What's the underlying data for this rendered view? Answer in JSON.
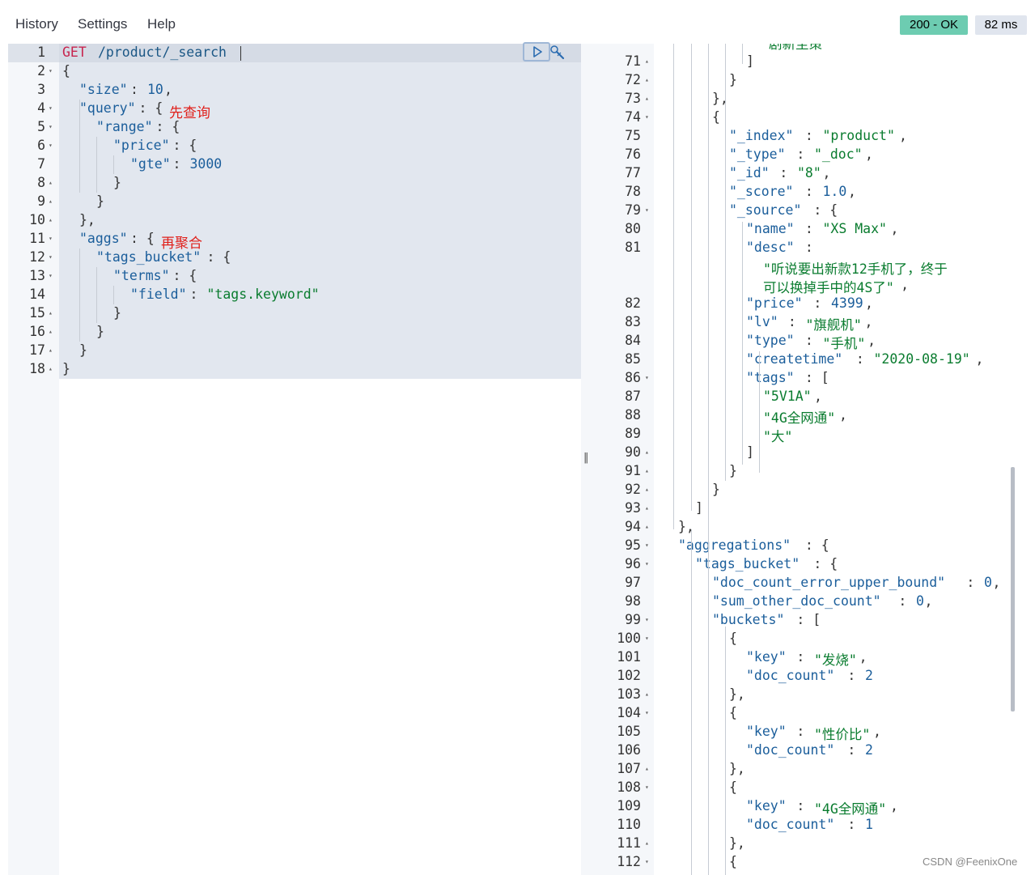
{
  "menu": {
    "history": "History",
    "settings": "Settings",
    "help": "Help"
  },
  "status": {
    "code": "200 - OK",
    "time": "82 ms"
  },
  "request": {
    "method": "GET",
    "url": "/product/_search",
    "lines": [
      {
        "n": "1"
      },
      {
        "n": "2",
        "t": [
          [
            "{",
            "punc"
          ]
        ]
      },
      {
        "n": "3",
        "t": [
          [
            "\"size\"",
            "key"
          ],
          [
            ": ",
            "punc"
          ],
          [
            "10",
            "num"
          ],
          [
            ",",
            "punc"
          ]
        ]
      },
      {
        "n": "4",
        "t": [
          [
            "\"query\"",
            "key"
          ],
          [
            ": {",
            "punc"
          ]
        ]
      },
      {
        "n": "5",
        "t": [
          [
            "\"range\"",
            "key"
          ],
          [
            ": {",
            "punc"
          ]
        ]
      },
      {
        "n": "6",
        "t": [
          [
            "\"price\"",
            "key"
          ],
          [
            ": {",
            "punc"
          ]
        ]
      },
      {
        "n": "7",
        "t": [
          [
            "\"gte\"",
            "key"
          ],
          [
            ": ",
            "punc"
          ],
          [
            "3000",
            "num"
          ]
        ]
      },
      {
        "n": "8",
        "t": [
          [
            "}",
            "punc"
          ]
        ]
      },
      {
        "n": "9",
        "t": [
          [
            "}",
            "punc"
          ]
        ]
      },
      {
        "n": "10",
        "t": [
          [
            "},",
            "punc"
          ]
        ]
      },
      {
        "n": "11",
        "t": [
          [
            "\"aggs\"",
            "key"
          ],
          [
            ": {",
            "punc"
          ]
        ]
      },
      {
        "n": "12",
        "t": [
          [
            "\"tags_bucket\"",
            "key"
          ],
          [
            ": {",
            "punc"
          ]
        ]
      },
      {
        "n": "13",
        "t": [
          [
            "\"terms\"",
            "key"
          ],
          [
            ": {",
            "punc"
          ]
        ]
      },
      {
        "n": "14",
        "t": [
          [
            "\"field\"",
            "key"
          ],
          [
            ": ",
            "punc"
          ],
          [
            "\"tags.keyword\"",
            "str"
          ]
        ]
      },
      {
        "n": "15",
        "t": [
          [
            "}",
            "punc"
          ]
        ]
      },
      {
        "n": "16",
        "t": [
          [
            "}",
            "punc"
          ]
        ]
      },
      {
        "n": "17",
        "t": [
          [
            "}",
            "punc"
          ]
        ]
      },
      {
        "n": "18",
        "t": [
          [
            "}",
            "punc"
          ]
        ]
      }
    ],
    "annotations": {
      "query_note": "先查询",
      "aggs_note": "再聚合"
    }
  },
  "response": {
    "partial_top_text": "剧新至策",
    "lines": [
      {
        "n": "71",
        "t": [
          [
            "]",
            "punc"
          ]
        ]
      },
      {
        "n": "72",
        "t": [
          [
            "}",
            "punc"
          ]
        ]
      },
      {
        "n": "73",
        "t": [
          [
            "},",
            "punc"
          ]
        ]
      },
      {
        "n": "74",
        "t": [
          [
            "{",
            "punc"
          ]
        ]
      },
      {
        "n": "75",
        "t": [
          [
            "\"_index\"",
            "key"
          ],
          [
            " : ",
            "punc"
          ],
          [
            "\"product\"",
            "str"
          ],
          [
            ",",
            "punc"
          ]
        ]
      },
      {
        "n": "76",
        "t": [
          [
            "\"_type\"",
            "key"
          ],
          [
            " : ",
            "punc"
          ],
          [
            "\"_doc\"",
            "str"
          ],
          [
            ",",
            "punc"
          ]
        ]
      },
      {
        "n": "77",
        "t": [
          [
            "\"_id\"",
            "key"
          ],
          [
            " : ",
            "punc"
          ],
          [
            "\"8\"",
            "str"
          ],
          [
            ",",
            "punc"
          ]
        ]
      },
      {
        "n": "78",
        "t": [
          [
            "\"_score\"",
            "key"
          ],
          [
            " : ",
            "punc"
          ],
          [
            "1.0",
            "num"
          ],
          [
            ",",
            "punc"
          ]
        ]
      },
      {
        "n": "79",
        "t": [
          [
            "\"_source\"",
            "key"
          ],
          [
            " : {",
            "punc"
          ]
        ]
      },
      {
        "n": "80",
        "t": [
          [
            "\"name\"",
            "key"
          ],
          [
            " : ",
            "punc"
          ],
          [
            "\"XS Max\"",
            "str"
          ],
          [
            ",",
            "punc"
          ]
        ]
      },
      {
        "n": "81",
        "t": [
          [
            "\"desc\"",
            "key"
          ],
          [
            " :",
            "punc"
          ]
        ]
      },
      {
        "n": "",
        "t": [
          [
            "\"听说要出新款12手机了，终于",
            "str"
          ]
        ]
      },
      {
        "n": "",
        "t": [
          [
            "可以换掉手中的4S了\"",
            "str"
          ],
          [
            ",",
            "punc"
          ]
        ]
      },
      {
        "n": "82",
        "t": [
          [
            "\"price\"",
            "key"
          ],
          [
            " : ",
            "punc"
          ],
          [
            "4399",
            "num"
          ],
          [
            ",",
            "punc"
          ]
        ]
      },
      {
        "n": "83",
        "t": [
          [
            "\"lv\"",
            "key"
          ],
          [
            " : ",
            "punc"
          ],
          [
            "\"旗舰机\"",
            "str"
          ],
          [
            ",",
            "punc"
          ]
        ]
      },
      {
        "n": "84",
        "t": [
          [
            "\"type\"",
            "key"
          ],
          [
            " : ",
            "punc"
          ],
          [
            "\"手机\"",
            "str"
          ],
          [
            ",",
            "punc"
          ]
        ]
      },
      {
        "n": "85",
        "t": [
          [
            "\"createtime\"",
            "key"
          ],
          [
            " : ",
            "punc"
          ],
          [
            "\"2020-08-19\"",
            "str"
          ],
          [
            ",",
            "punc"
          ]
        ]
      },
      {
        "n": "86",
        "t": [
          [
            "\"tags\"",
            "key"
          ],
          [
            " : [",
            "punc"
          ]
        ]
      },
      {
        "n": "87",
        "t": [
          [
            "\"5V1A\"",
            "str"
          ],
          [
            ",",
            "punc"
          ]
        ]
      },
      {
        "n": "88",
        "t": [
          [
            "\"4G全网通\"",
            "str"
          ],
          [
            ",",
            "punc"
          ]
        ]
      },
      {
        "n": "89",
        "t": [
          [
            "\"大\"",
            "str"
          ]
        ]
      },
      {
        "n": "90",
        "t": [
          [
            "]",
            "punc"
          ]
        ]
      },
      {
        "n": "91",
        "t": [
          [
            "}",
            "punc"
          ]
        ]
      },
      {
        "n": "92",
        "t": [
          [
            "}",
            "punc"
          ]
        ]
      },
      {
        "n": "93",
        "t": [
          [
            "]",
            "punc"
          ]
        ]
      },
      {
        "n": "94",
        "t": [
          [
            "},",
            "punc"
          ]
        ]
      },
      {
        "n": "95",
        "t": [
          [
            "\"aggregations\"",
            "key"
          ],
          [
            " : {",
            "punc"
          ]
        ]
      },
      {
        "n": "96",
        "t": [
          [
            "\"tags_bucket\"",
            "key"
          ],
          [
            " : {",
            "punc"
          ]
        ]
      },
      {
        "n": "97",
        "t": [
          [
            "\"doc_count_error_upper_bound\"",
            "key"
          ],
          [
            " : ",
            "punc"
          ],
          [
            "0",
            "num"
          ],
          [
            ",",
            "punc"
          ]
        ]
      },
      {
        "n": "98",
        "t": [
          [
            "\"sum_other_doc_count\"",
            "key"
          ],
          [
            " : ",
            "punc"
          ],
          [
            "0",
            "num"
          ],
          [
            ",",
            "punc"
          ]
        ]
      },
      {
        "n": "99",
        "t": [
          [
            "\"buckets\"",
            "key"
          ],
          [
            " : [",
            "punc"
          ]
        ]
      },
      {
        "n": "100",
        "t": [
          [
            "{",
            "punc"
          ]
        ]
      },
      {
        "n": "101",
        "t": [
          [
            "\"key\"",
            "key"
          ],
          [
            " : ",
            "punc"
          ],
          [
            "\"发烧\"",
            "str"
          ],
          [
            ",",
            "punc"
          ]
        ]
      },
      {
        "n": "102",
        "t": [
          [
            "\"doc_count\"",
            "key"
          ],
          [
            " : ",
            "punc"
          ],
          [
            "2",
            "num"
          ]
        ]
      },
      {
        "n": "103",
        "t": [
          [
            "},",
            "punc"
          ]
        ]
      },
      {
        "n": "104",
        "t": [
          [
            "{",
            "punc"
          ]
        ]
      },
      {
        "n": "105",
        "t": [
          [
            "\"key\"",
            "key"
          ],
          [
            " : ",
            "punc"
          ],
          [
            "\"性价比\"",
            "str"
          ],
          [
            ",",
            "punc"
          ]
        ]
      },
      {
        "n": "106",
        "t": [
          [
            "\"doc_count\"",
            "key"
          ],
          [
            " : ",
            "punc"
          ],
          [
            "2",
            "num"
          ]
        ]
      },
      {
        "n": "107",
        "t": [
          [
            "},",
            "punc"
          ]
        ]
      },
      {
        "n": "108",
        "t": [
          [
            "{",
            "punc"
          ]
        ]
      },
      {
        "n": "109",
        "t": [
          [
            "\"key\"",
            "key"
          ],
          [
            " : ",
            "punc"
          ],
          [
            "\"4G全网通\"",
            "str"
          ],
          [
            ",",
            "punc"
          ]
        ]
      },
      {
        "n": "110",
        "t": [
          [
            "\"doc_count\"",
            "key"
          ],
          [
            " : ",
            "punc"
          ],
          [
            "1",
            "num"
          ]
        ]
      },
      {
        "n": "111",
        "t": [
          [
            "},",
            "punc"
          ]
        ]
      },
      {
        "n": "112",
        "t": [
          [
            "{",
            "punc"
          ]
        ]
      }
    ]
  },
  "watermark": "CSDN @FeenixOne"
}
